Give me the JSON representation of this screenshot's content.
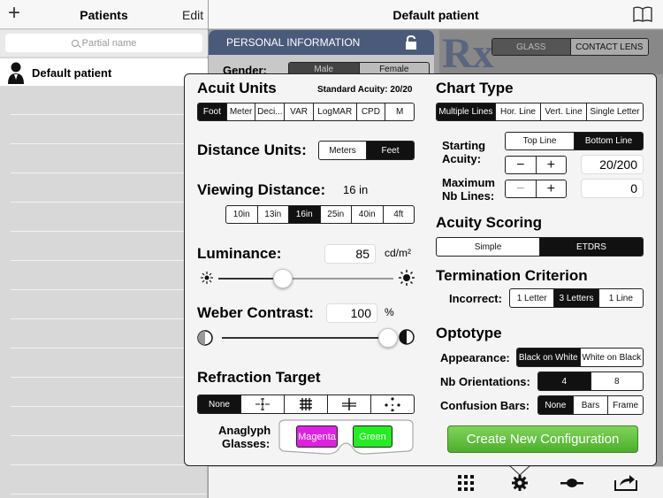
{
  "nav_left": {
    "add_label": "+",
    "title": "Patients",
    "edit_label": "Edit"
  },
  "nav_right": {
    "title": "Default patient"
  },
  "search": {
    "placeholder": "Partial name"
  },
  "patients": [
    {
      "name": "Default patient"
    }
  ],
  "background": {
    "personal_info_title": "PERSONAL INFORMATION",
    "gender_label": "Gender:",
    "gender_options": [
      "Male",
      "Female"
    ],
    "rx_mark": "Rx",
    "lens_options": [
      "GLASS",
      "CONTACT LENS"
    ]
  },
  "acuity_units": {
    "title": "Acuit Units",
    "standard_label": "Standard Acuity: 20/20",
    "options": [
      "Foot",
      "Meter",
      "Deci...",
      "VAR",
      "LogMAR",
      "CPD",
      "M"
    ],
    "selected": "Foot"
  },
  "distance_units": {
    "title": "Distance Units:",
    "options": [
      "Meters",
      "Feet"
    ],
    "selected": "Feet"
  },
  "viewing_distance": {
    "title": "Viewing Distance:",
    "value": "16 in",
    "options": [
      "10in",
      "13in",
      "16in",
      "25in",
      "40in",
      "4ft"
    ],
    "selected": "16in"
  },
  "luminance": {
    "title": "Luminance:",
    "value": "85",
    "unit": "cd/m²",
    "slider_fraction": 0.37
  },
  "weber_contrast": {
    "title": "Weber Contrast:",
    "value": "100",
    "unit": "%",
    "slider_fraction": 1.0
  },
  "refraction_target": {
    "title": "Refraction Target",
    "options": [
      "None",
      "vertical-horizontal-target-icon",
      "grid-target-icon",
      "cross-target-icon",
      "dots-target-icon"
    ],
    "selected_label": "None"
  },
  "anaglyph": {
    "label_line1": "Anaglyph",
    "label_line2": "Glasses:",
    "left_label": "Magenta",
    "right_label": "Green",
    "left_color": "#e020e0",
    "right_color": "#22ee22"
  },
  "chart_type": {
    "title": "Chart Type",
    "options": [
      "Multiple Lines",
      "Hor. Line",
      "Vert. Line",
      "Single Letter"
    ],
    "selected": "Multiple Lines"
  },
  "starting_acuity": {
    "label_line1": "Starting",
    "label_line2": "Acuity:",
    "options": [
      "Top Line",
      "Bottom Line"
    ],
    "selected": "Bottom Line",
    "minus": "−",
    "plus": "+",
    "value": "20/200"
  },
  "max_lines": {
    "label_line1": "Maximum",
    "label_line2": "Nb Lines:",
    "minus": "−",
    "plus": "+",
    "value": "0"
  },
  "acuity_scoring": {
    "title": "Acuity Scoring",
    "options": [
      "Simple",
      "ETDRS"
    ],
    "selected": "ETDRS"
  },
  "termination": {
    "title": "Termination Criterion",
    "label": "Incorrect:",
    "options": [
      "1 Letter",
      "3 Letters",
      "1 Line"
    ],
    "selected": "3 Letters"
  },
  "optotype": {
    "title": "Optotype",
    "appearance_label": "Appearance:",
    "appearance_options": [
      "Black on White",
      "White on Black"
    ],
    "appearance_selected": "Black on White",
    "orientations_label": "Nb Orientations:",
    "orientation_options": [
      "4",
      "8"
    ],
    "orientation_selected": "4",
    "bars_label": "Confusion Bars:",
    "bars_options": [
      "None",
      "Bars",
      "Frame"
    ],
    "bars_selected": "None"
  },
  "create_button": {
    "label": "Create New Configuration",
    "color": "#4caf2a"
  },
  "tabbar": [
    "grid-icon",
    "gear-icon",
    "slider-icon",
    "share-icon"
  ]
}
